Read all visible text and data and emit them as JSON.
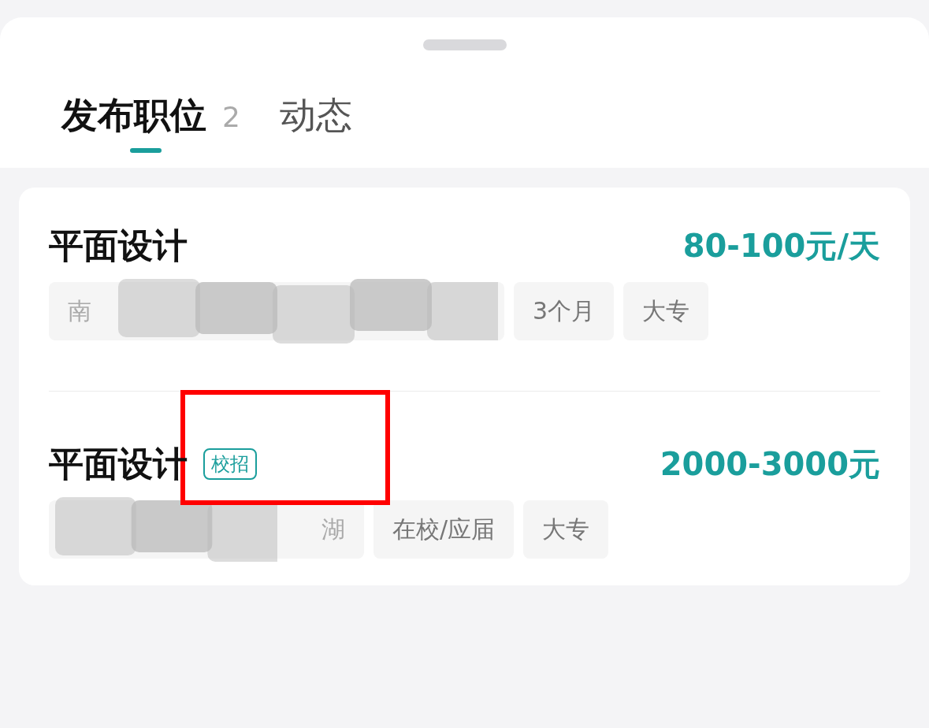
{
  "tabs": [
    {
      "label": "发布职位",
      "count": "2",
      "selected": true
    },
    {
      "label": "动态",
      "selected": false
    }
  ],
  "jobs": [
    {
      "title": "平面设计",
      "salary": "80-100元/天",
      "tags": [
        {
          "text": "南",
          "redacted": true
        },
        {
          "text": "3个月",
          "redacted": false
        },
        {
          "text": "大专",
          "redacted": false
        }
      ]
    },
    {
      "title": "平面设计",
      "badge": "校招",
      "salary": "2000-3000元",
      "tags": [
        {
          "text": "湖",
          "redacted": true
        },
        {
          "text": "在校/应届",
          "redacted": false
        },
        {
          "text": "大专",
          "redacted": false
        }
      ]
    }
  ],
  "annotation": {
    "kind": "highlight-rectangle"
  }
}
